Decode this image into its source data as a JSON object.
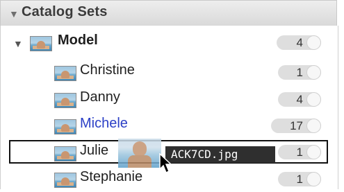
{
  "panel": {
    "title": "Catalog Sets"
  },
  "tree": {
    "parent": {
      "label": "Model",
      "count": "4"
    },
    "children": [
      {
        "label": "Christine",
        "count": "1"
      },
      {
        "label": "Danny",
        "count": "4"
      },
      {
        "label": "Michele",
        "count": "17"
      },
      {
        "label": "Julie",
        "count": "1"
      },
      {
        "label": "Stephanie",
        "count": "1"
      }
    ]
  },
  "drag": {
    "filename": "ACK7CD.jpg"
  },
  "colors": {
    "header_bg": "#e3e3e3",
    "link_blue": "#2b3fc6",
    "count_pill": "#dedede",
    "drag_label_bg": "#2f2f2f"
  },
  "icons": {
    "header_toggle": "disclosure-triangle-down",
    "folder_toggle": "disclosure-triangle-down",
    "set_thumbnail": "photo-thumbnail",
    "cursor": "arrow-cursor"
  }
}
